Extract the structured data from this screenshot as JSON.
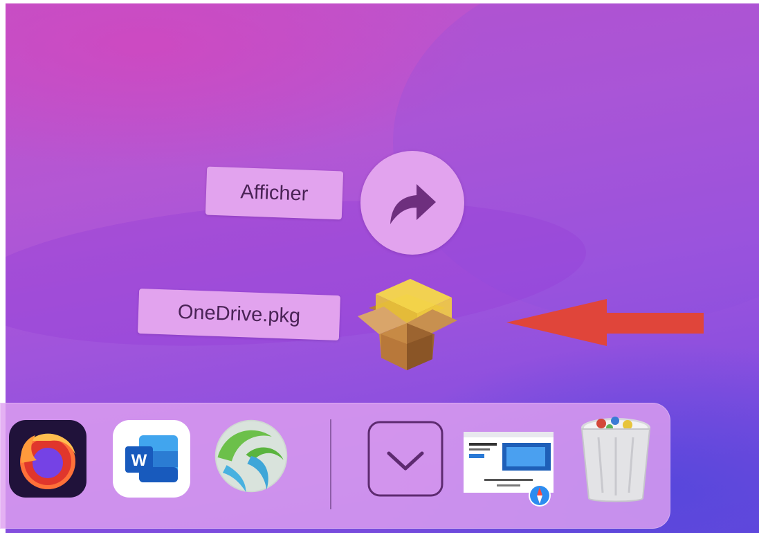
{
  "fan": {
    "show_label": "Afficher",
    "file_label": "OneDrive.pkg"
  },
  "icons": {
    "show": "curved-arrow-icon",
    "file": "package-box-icon",
    "annotation": "red-arrow-icon"
  },
  "dock": {
    "apps": [
      "firefox-icon",
      "microsoft-word-icon",
      "network-globe-icon",
      "downloads-stack-icon",
      "document-preview-icon",
      "trash-icon"
    ],
    "word_letter": "W"
  },
  "colors": {
    "label_bg": "#e2a3ee",
    "label_text": "#4a2356",
    "annotation_arrow": "#e0453a"
  }
}
